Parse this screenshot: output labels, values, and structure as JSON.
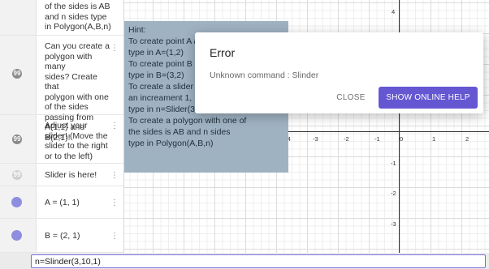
{
  "algebra": {
    "row0_text": "of the sides is AB\nand n sides type\nin Polygon(A,B,n)",
    "row1_text": "Can you create a\npolygon with many\nsides? Create that\npolygon with one\nof the sides\npassing from\nA(1,1) and B(2,1)!",
    "row2_text": "Adjust your\nslider! (Move the\nslider to the right\nor to the left)",
    "row3_text": "Slider is here!",
    "row4_text": "A = (1, 1)",
    "row5_text": "B = (2, 1)",
    "text_icon_glyph": "99",
    "point_color": "#8e8ee0"
  },
  "hint": {
    "lines": [
      "Hint:",
      "To create point A and B",
      "type in A=(1,2)",
      "To create point B",
      "type in B=(3,2)",
      "To create a slider with",
      "an increament 1,",
      "type in n=Slider(3,10,1)",
      "To create a polygon with one of",
      "the sides is AB and n sides",
      "type in Polygon(A,B,n)"
    ]
  },
  "graph": {
    "x_ticks": [
      "-4",
      "-3",
      "-2",
      "-1",
      "0",
      "1",
      "2"
    ],
    "y_ticks": [
      "4",
      "-1",
      "-2",
      "-3"
    ]
  },
  "dialog": {
    "title": "Error",
    "message": "Unknown command : Slinder",
    "close_label": "CLOSE",
    "help_label": "SHOW ONLINE HELP",
    "accent_color": "#6557d2"
  },
  "input": {
    "value": "n=Slinder(3,10,1)"
  }
}
